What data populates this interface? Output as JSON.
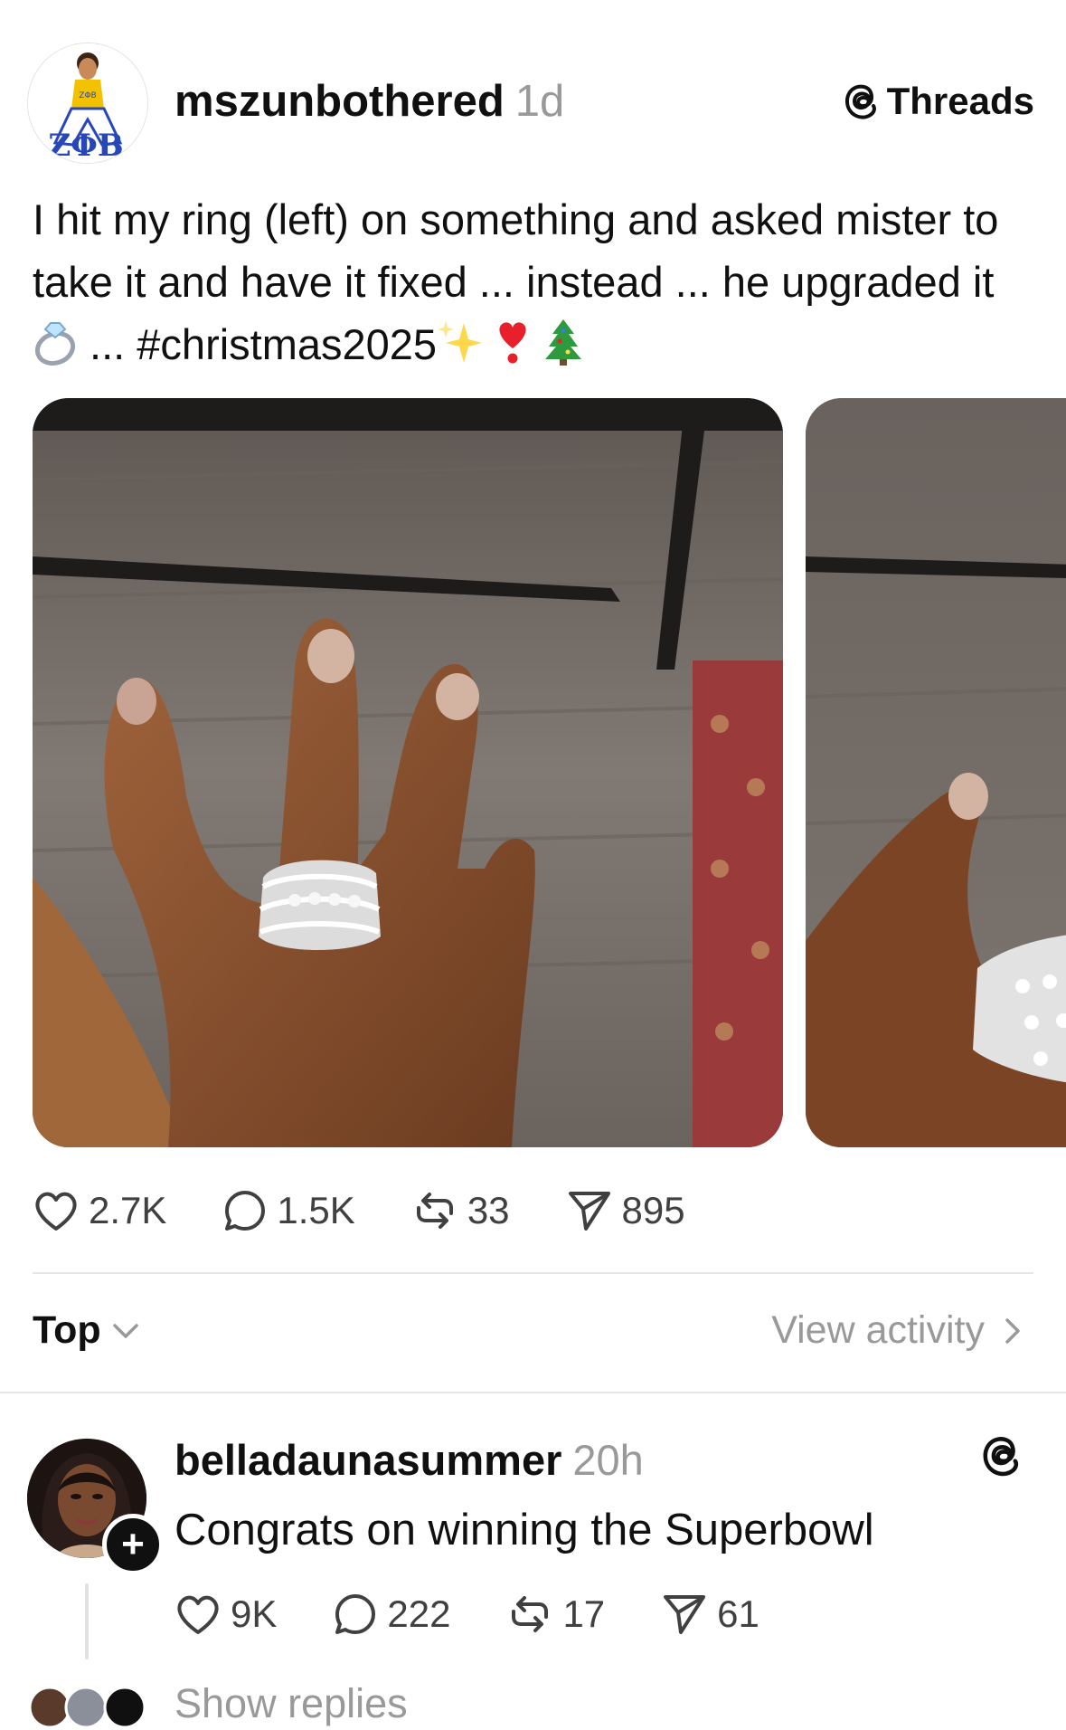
{
  "post": {
    "username": "mszunbothered",
    "time": "1d",
    "badge": "Threads",
    "text_part1": "I hit my ring (left) on something and asked mister to take it and have it fixed ... instead ... he upgraded it",
    "text_part2": " ... #christmas2025",
    "emojis": [
      "ring-icon",
      "sparkles-icon",
      "heart-exclamation-icon",
      "christmas-tree-icon"
    ],
    "media_count": 2,
    "stats": {
      "likes": "2.7K",
      "comments": "1.5K",
      "reposts": "33",
      "shares": "895"
    }
  },
  "sort": {
    "label": "Top",
    "view_activity": "View activity"
  },
  "reply": {
    "username": "belladaunasummer",
    "time": "20h",
    "text": "Congrats on winning the Superbowl",
    "follow_symbol": "+",
    "stats": {
      "likes": "9K",
      "comments": "222",
      "reposts": "17",
      "shares": "61"
    }
  },
  "show_replies": "Show replies",
  "colors": {
    "text": "#101010",
    "muted": "#999999",
    "icon": "#404040",
    "divider": "#e6e6e6"
  }
}
